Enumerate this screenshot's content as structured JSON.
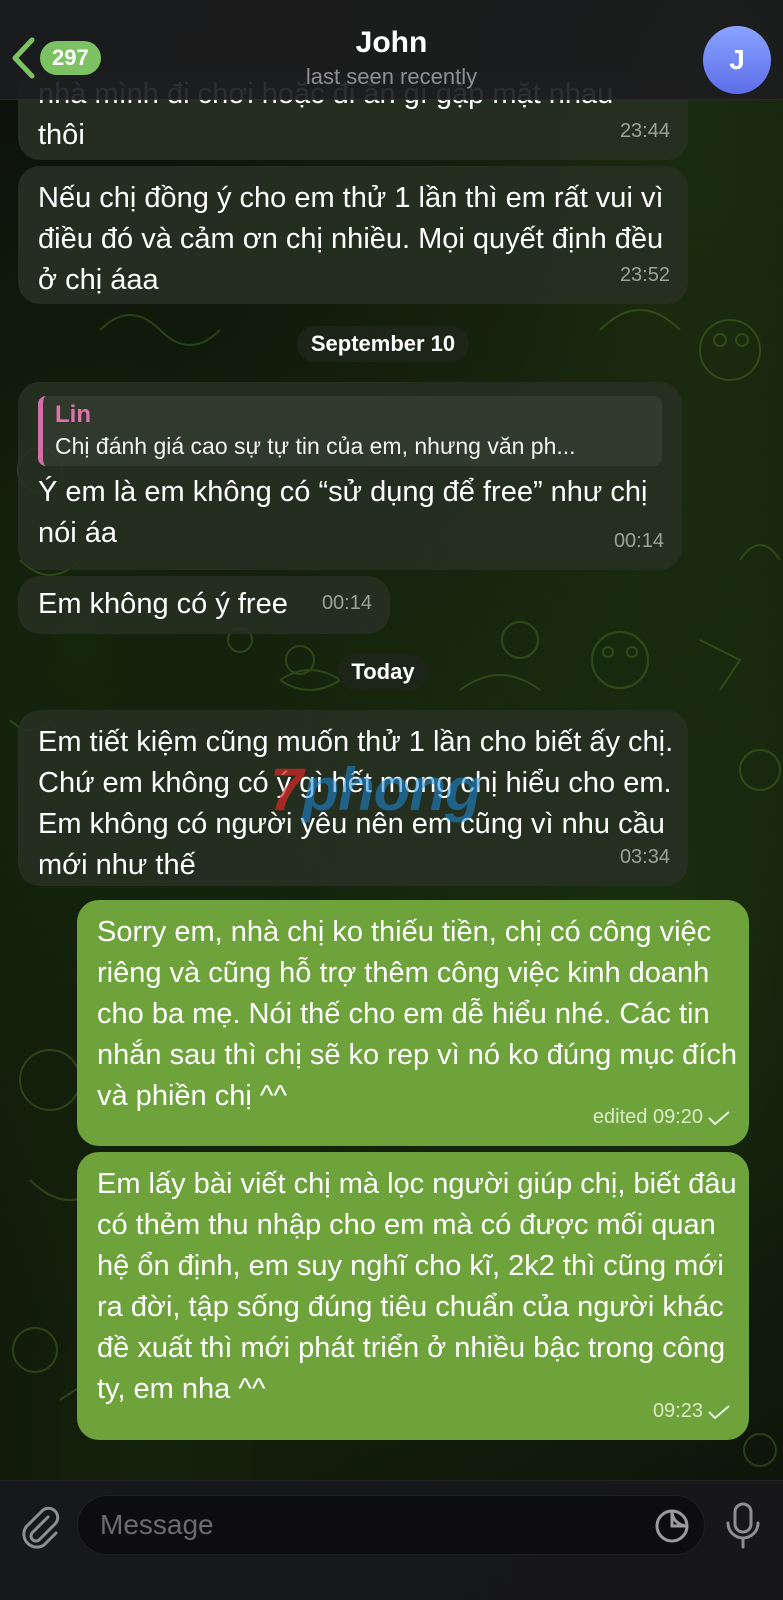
{
  "header": {
    "back_count": "297",
    "title": "John",
    "subtitle": "last seen recently",
    "avatar_letter": "J"
  },
  "messages": [
    {
      "text": "nhà mình đi chơi hoặc đi ăn gì gặp mặt nhau\nthôi",
      "time": "23:44"
    },
    {
      "text": "Nếu chị đồng ý cho em thử 1 lần thì em rất vui vì điều đó và cảm ơn chị nhiều. Mọi quyết định đều ở chị áaa",
      "time": "23:52"
    },
    {
      "date": "September 10"
    },
    {
      "reply_name": "Lin",
      "reply_text": "Chị đánh giá cao sự tự tin của em, nhưng văn ph...",
      "text": "Ý em là em không có “sử dụng để free” như chị nói áa",
      "time": "00:14"
    },
    {
      "text": "Em không có ý free",
      "time": "00:14"
    },
    {
      "date": "Today"
    },
    {
      "text": "Em tiết kiệm cũng muốn thử 1 lần cho biết ấy chị. Chứ em không có ý gì hết mong chị hiểu cho em. Em không có người yêu nên em cũng vì nhu cầu mới như thế",
      "time": "03:34"
    },
    {
      "text": "Sorry em, nhà chị ko thiếu tiền, chị có công việc riêng và cũng hỗ trợ thêm công việc kinh doanh cho ba mẹ. Nói thế cho em dễ hiểu nhé. Các tin nhắn sau thì chị sẽ ko rep vì nó ko đúng mục đích và phiền chị ^^",
      "time": "edited 09:20"
    },
    {
      "text": "Em lấy bài viết chị mà lọc người giúp chị, biết đâu có thẻm thu nhập cho em mà có được mối quan hệ ổn định, em suy nghĩ cho kĩ, 2k2 thì cũng mới ra đời, tập sống đúng tiêu chuẩn của người khác đề xuất thì mới phát triển ở nhiều bậc trong công ty, em nha ^^",
      "time": "09:23"
    }
  ],
  "watermark": {
    "first": "7",
    "rest": "phong"
  },
  "input": {
    "placeholder": "Message"
  },
  "colors": {
    "accent": "#7cc263",
    "outgoing_bubble": "#6ea33c",
    "incoming_bubble": "#263022",
    "reply_bar": "#d36fa6"
  }
}
